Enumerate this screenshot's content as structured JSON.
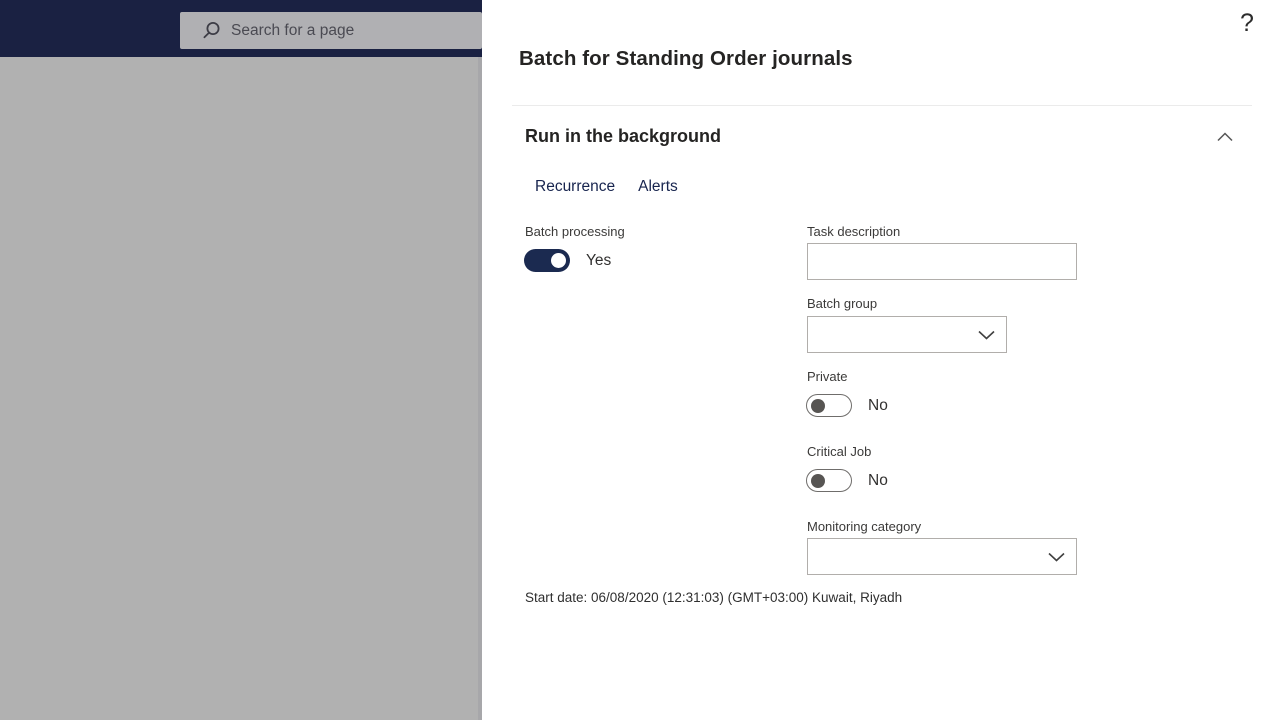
{
  "background": {
    "search": {
      "placeholder": "Search for a page",
      "icon": "search-icon"
    }
  },
  "help": {
    "label": "?"
  },
  "dialog": {
    "title": "Batch for Standing Order journals",
    "section": {
      "title": "Run in the background",
      "collapse_icon": "chevron-up-icon",
      "expanded": true
    },
    "tabs": [
      {
        "label": "Recurrence"
      },
      {
        "label": "Alerts"
      }
    ],
    "fields": {
      "batch_processing": {
        "label": "Batch processing",
        "value": "Yes",
        "toggle_on": true
      },
      "task_description": {
        "label": "Task description",
        "value": ""
      },
      "batch_group": {
        "label": "Batch group",
        "value": ""
      },
      "private": {
        "label": "Private",
        "value": "No",
        "toggle_on": false
      },
      "critical_job": {
        "label": "Critical Job",
        "value": "No",
        "toggle_on": false
      },
      "monitoring_category": {
        "label": "Monitoring category",
        "value": ""
      }
    },
    "start_date_text": "Start date: 06/08/2020 (12:31:03) (GMT+03:00) Kuwait, Riyadh"
  },
  "colors": {
    "header_navy": "#1a2142",
    "toggle_on_navy": "#1b2a50",
    "overlay_gray": "#b1b1b1",
    "tab_link_navy": "#17244e",
    "input_border": "#b1aeab"
  }
}
